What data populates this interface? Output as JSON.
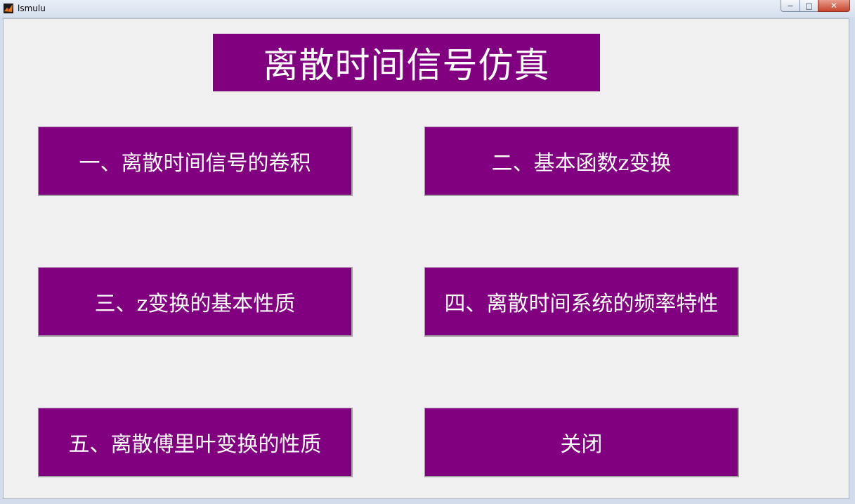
{
  "window": {
    "title": "lsmulu",
    "controls": {
      "minimize": "−",
      "maximize": "□",
      "close": "✕"
    }
  },
  "main": {
    "title": "离散时间信号仿真",
    "buttons": [
      {
        "id": "btn1",
        "label": "一、离散时间信号的卷积"
      },
      {
        "id": "btn2",
        "label": "二、基本函数z变换"
      },
      {
        "id": "btn3",
        "label": "三、z变换的基本性质"
      },
      {
        "id": "btn4",
        "label": "四、离散时间系统的频率特性"
      },
      {
        "id": "btn5",
        "label": "五、离散傅里叶变换的性质"
      },
      {
        "id": "btn6",
        "label": "关闭"
      }
    ]
  },
  "colors": {
    "button_bg": "#800080",
    "button_text": "#ffffff",
    "window_bg": "#f0f0f0"
  }
}
